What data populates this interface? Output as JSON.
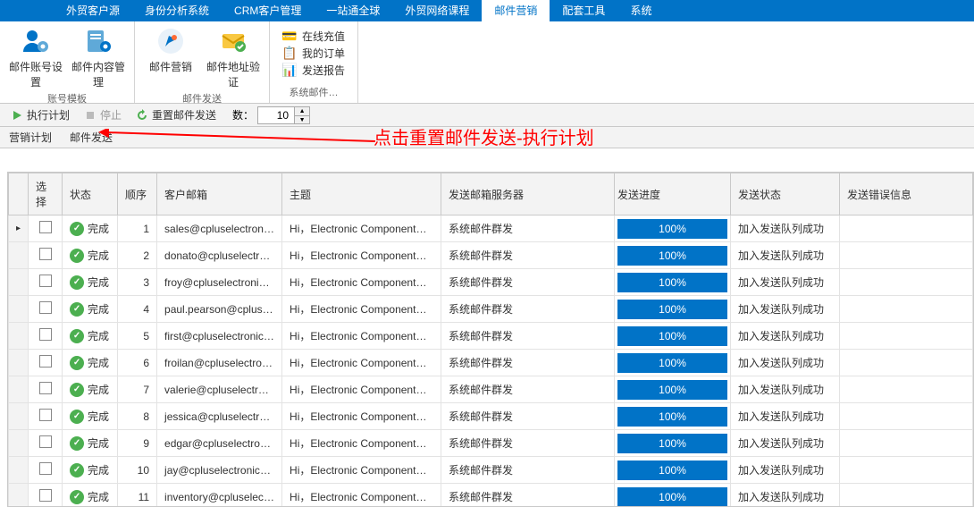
{
  "menu": {
    "items": [
      "外贸客户源",
      "身份分析系统",
      "CRM客户管理",
      "一站通全球",
      "外贸网络课程",
      "邮件营销",
      "配套工具",
      "系统"
    ],
    "activeIndex": 5
  },
  "ribbon": {
    "group1": {
      "label": "账号模板",
      "buttons": [
        {
          "label": "邮件账号设置"
        },
        {
          "label": "邮件内容管理"
        }
      ]
    },
    "group2": {
      "label": "邮件发送",
      "buttons": [
        {
          "label": "邮件营销"
        },
        {
          "label": "邮件地址验证"
        }
      ]
    },
    "group3": {
      "label": "系统邮件…",
      "items": [
        {
          "label": "在线充值"
        },
        {
          "label": "我的订单"
        },
        {
          "label": "发送报告"
        }
      ]
    }
  },
  "toolbar": {
    "execute": "执行计划",
    "stop": "停止",
    "reset": "重置邮件发送",
    "countLabel": "数：",
    "countValue": "10"
  },
  "subtabs": {
    "tab1": "营销计划",
    "tab2": "邮件发送"
  },
  "annotation": "点击重置邮件发送-执行计划",
  "columns": {
    "select": "选择",
    "status": "状态",
    "seq": "顺序",
    "email": "客户邮箱",
    "subject": "主题",
    "server": "发送邮箱服务器",
    "progress": "发送进度",
    "sendstatus": "发送状态",
    "errinfo": "发送错误信息"
  },
  "statusText": "完成",
  "subjectText": "Hi，Electronic Component，…",
  "serverText": "系统邮件群发",
  "progressText": "100%",
  "sendStatusText": "加入发送队列成功",
  "rows": [
    {
      "seq": 1,
      "email": "sales@cpluselectronics.…"
    },
    {
      "seq": 2,
      "email": "donato@cpluselectroni…"
    },
    {
      "seq": 3,
      "email": "froy@cpluselectronics.…"
    },
    {
      "seq": 4,
      "email": "paul.pearson@cplusele…"
    },
    {
      "seq": 5,
      "email": "first@cpluselectronics.…"
    },
    {
      "seq": 6,
      "email": "froilan@cpluselectronic…"
    },
    {
      "seq": 7,
      "email": "valerie@cpluselectroni…"
    },
    {
      "seq": 8,
      "email": "jessica@cpluselectroni…"
    },
    {
      "seq": 9,
      "email": "edgar@cpluselectronic…"
    },
    {
      "seq": 10,
      "email": "jay@cpluselectronics.c…"
    },
    {
      "seq": 11,
      "email": "inventory@cpluselectro…"
    }
  ]
}
